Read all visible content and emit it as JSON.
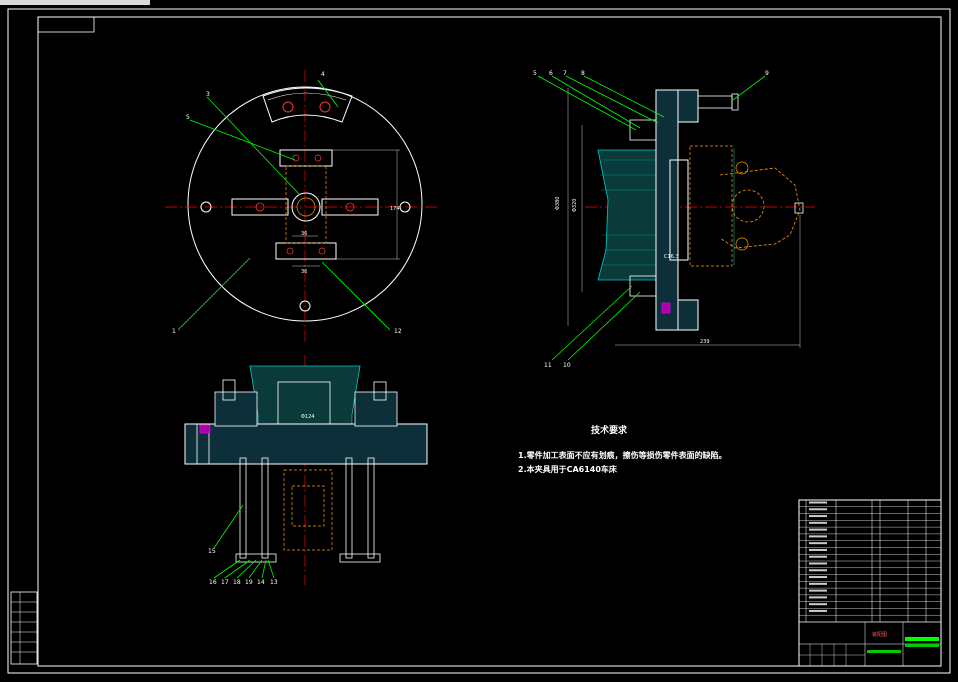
{
  "top_strip_label": "",
  "technical_requirements": {
    "title": "技术要求",
    "lines": [
      "1.零件加工表面不应有划痕，擦伤等损伤零件表面的缺陷。",
      "2.本夹具用于CA6140车床"
    ]
  },
  "top_view_callouts": [
    "4",
    "3",
    "5",
    "1",
    "12"
  ],
  "side_view_callouts": [
    "5",
    "6",
    "7",
    "8",
    "9",
    "11",
    "10"
  ],
  "front_view_callouts": [
    "15",
    "16",
    "17",
    "18",
    "19",
    "14",
    "13"
  ],
  "dimensions": {
    "top_width": "174",
    "top_slot": "36",
    "top_small": "36",
    "side_overall": "239",
    "side_bore": "Φ380",
    "side_inner": "Φ320",
    "front_mid": "Φ124",
    "side_note": "C16.3"
  },
  "title_block": {
    "drawing_name": "装配图",
    "parts_rows": 18
  },
  "colors": {
    "background": "#000000",
    "outline": "#ffffff",
    "centerline": "#ff0000",
    "leader": "#00ff00",
    "hidden": "#ff9900",
    "section": "#00cccc",
    "dim": "#00ffff",
    "accent": "#ff00ff"
  }
}
